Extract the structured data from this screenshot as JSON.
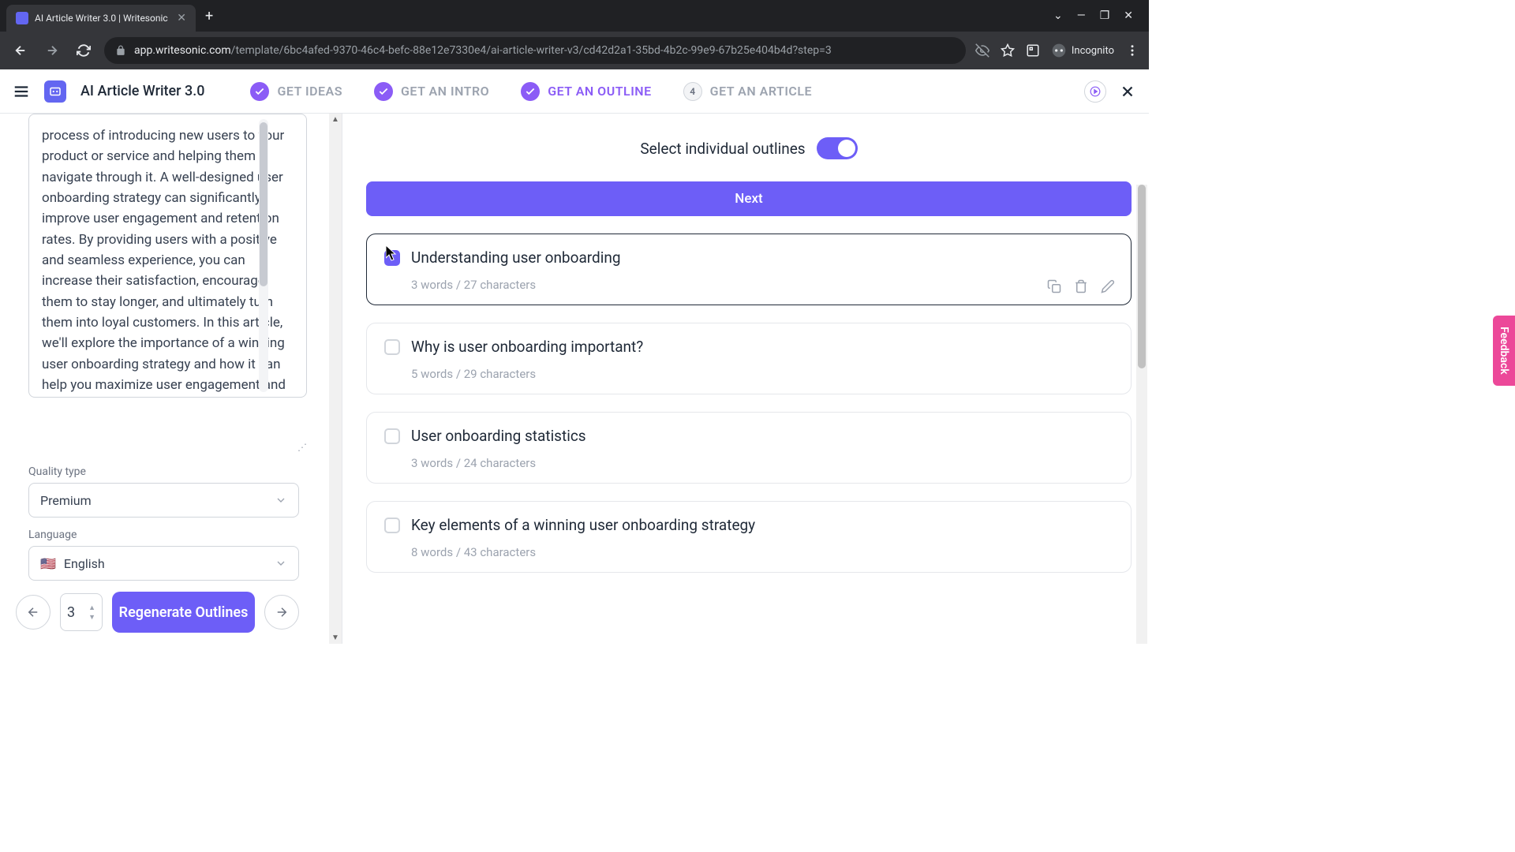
{
  "browser": {
    "tab_title": "AI Article Writer 3.0 | Writesonic",
    "url_domain": "app.writesonic.com",
    "url_path": "/template/6bc4afed-9370-46c4-befc-88e12e7330e4/ai-article-writer-v3/cd42d2a1-35bd-4b2c-99e9-67b25e404b4d?step=3",
    "incognito": "Incognito"
  },
  "header": {
    "app_title": "AI Article Writer 3.0",
    "steps": [
      {
        "label": "GET IDEAS",
        "state": "done"
      },
      {
        "label": "GET AN INTRO",
        "state": "done"
      },
      {
        "label": "GET AN OUTLINE",
        "state": "active"
      },
      {
        "label": "GET AN ARTICLE",
        "state": "pending",
        "num": "4"
      }
    ]
  },
  "left": {
    "intro_text": "process of introducing new users to your product or service and helping them navigate through it. A well-designed user onboarding strategy can significantly improve user engagement and retention rates. By providing users with a positive and seamless experience, you can increase their satisfaction, encourage them to stay longer, and ultimately turn them into loyal customers. In this article, we'll explore the importance of a winning user onboarding strategy and how it can help you maximize user engagement and retention. We'll also discuss some best practices for designing an effective user onboarding process that will keep your",
    "quality_label": "Quality type",
    "quality_value": "Premium",
    "language_label": "Language",
    "language_value": "English",
    "count": "3",
    "regenerate": "Regenerate Outlines"
  },
  "right": {
    "toggle_label": "Select individual outlines",
    "next": "Next",
    "outlines": [
      {
        "title": "Understanding user onboarding",
        "meta": "3 words / 27 characters",
        "checked": true
      },
      {
        "title": "Why is user onboarding important?",
        "meta": "5 words / 29 characters",
        "checked": false
      },
      {
        "title": "User onboarding statistics",
        "meta": "3 words / 24 characters",
        "checked": false
      },
      {
        "title": "Key elements of a winning user onboarding strategy",
        "meta": "8 words / 43 characters",
        "checked": false
      }
    ]
  },
  "feedback": "Feedback"
}
